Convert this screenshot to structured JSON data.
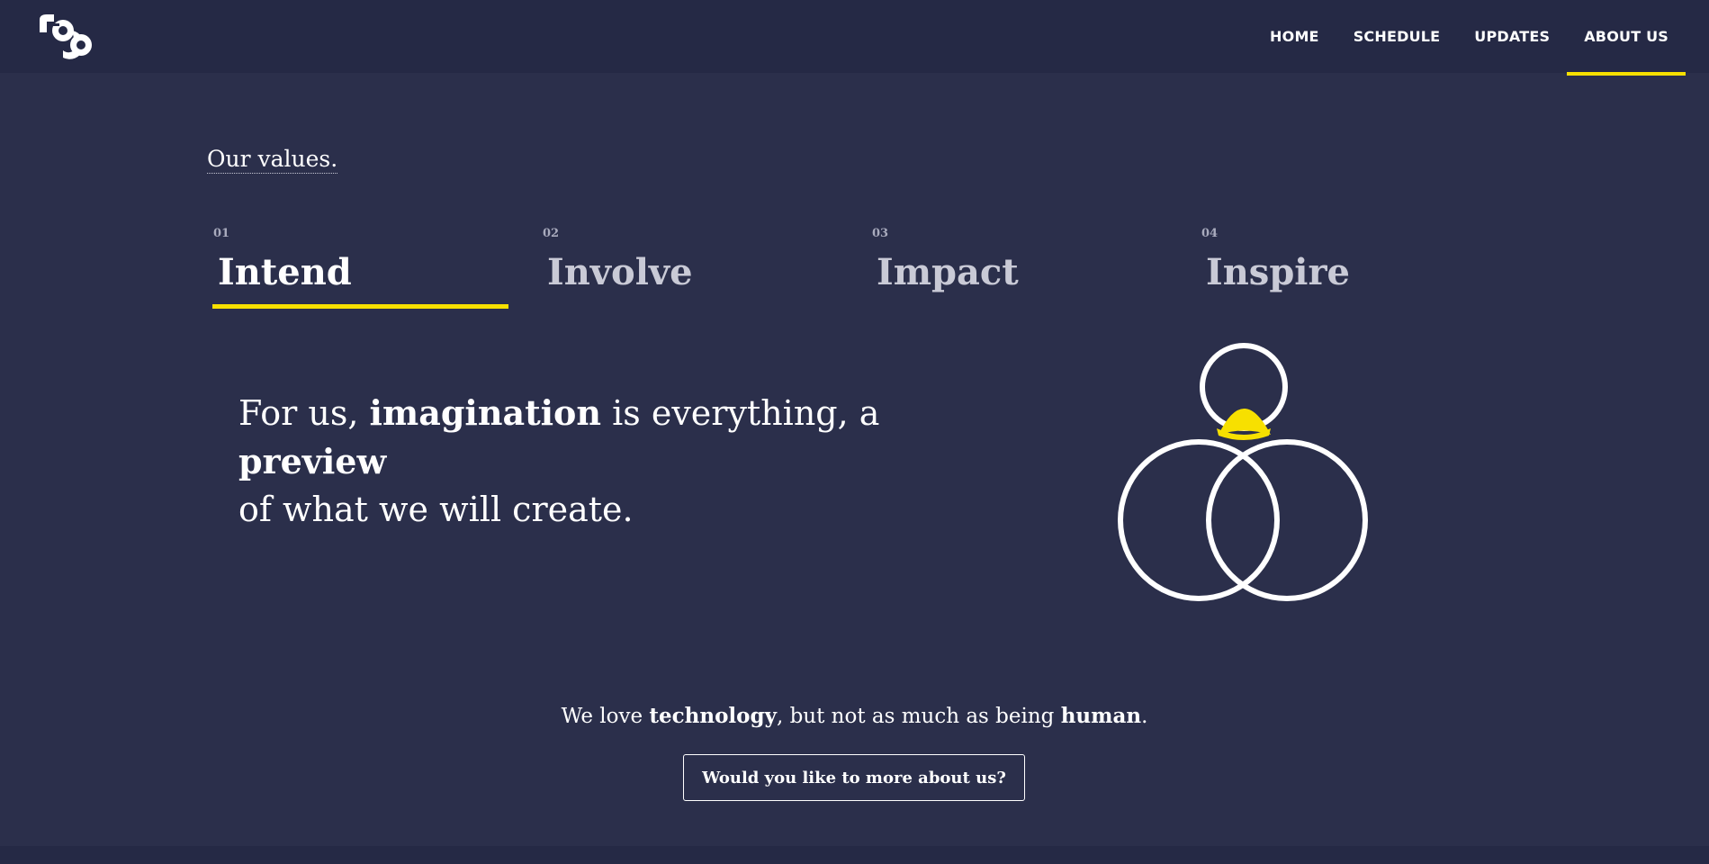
{
  "header": {
    "logo_icon": "mg-logo-icon",
    "nav": [
      {
        "label": "HOME",
        "active": false
      },
      {
        "label": "SCHEDULE",
        "active": false
      },
      {
        "label": "UPDATES",
        "active": false
      },
      {
        "label": "ABOUT US",
        "active": true
      }
    ]
  },
  "values": {
    "title": "Our values.",
    "tabs": [
      {
        "num": "01",
        "label": "Intend",
        "active": true
      },
      {
        "num": "02",
        "label": "Involve",
        "active": false
      },
      {
        "num": "03",
        "label": "Impact",
        "active": false
      },
      {
        "num": "04",
        "label": "Inspire",
        "active": false
      }
    ],
    "statement": {
      "part1": "For us, ",
      "bold1": "imagination",
      "part2": " is everything, a ",
      "bold2": "preview",
      "part3": "of what we will create."
    },
    "graphic_icon": "intend-circles-icon"
  },
  "tagline": {
    "part1": "We love ",
    "bold1": "technology",
    "part2": ", but not as much as being ",
    "bold2": "human",
    "part3": "."
  },
  "cta": {
    "label": "Would you like to more about us?"
  },
  "colors": {
    "background": "#2b2f4b",
    "header": "#252945",
    "accent": "#f7e000",
    "text": "#ffffff",
    "muted": "#c9cad6"
  }
}
